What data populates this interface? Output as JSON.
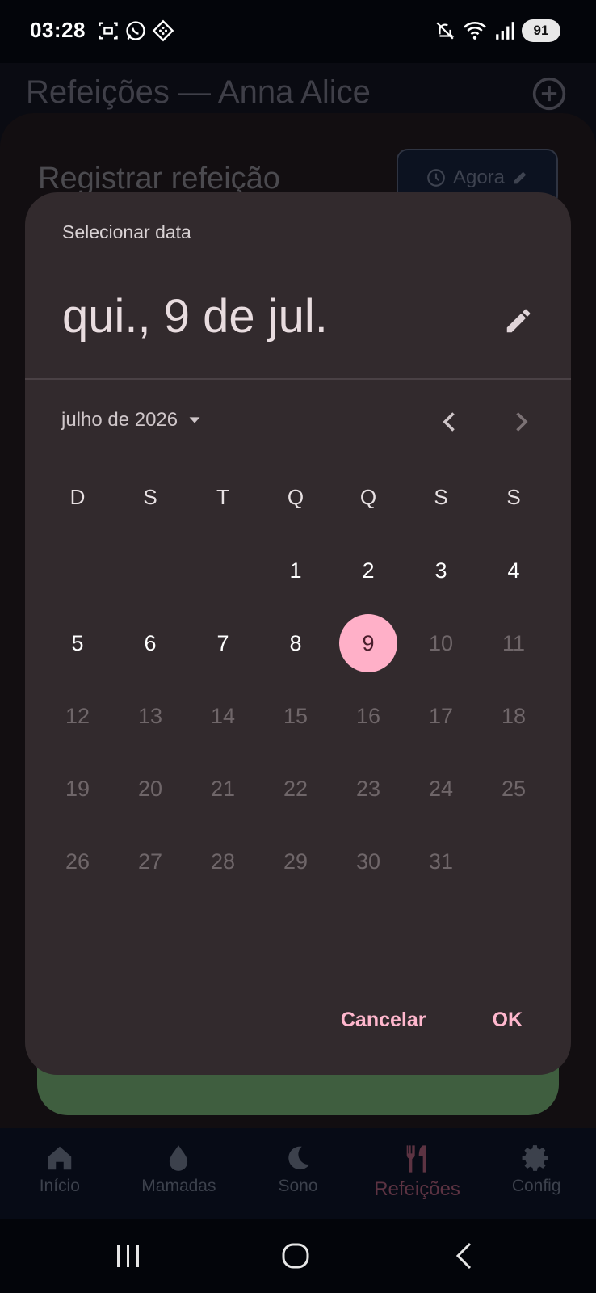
{
  "status_bar": {
    "time": "03:28",
    "battery": "91",
    "left_icons": [
      "screenshot-icon",
      "whatsapp-icon",
      "app-grid-icon"
    ],
    "right_icons": [
      "mute-icon",
      "wifi-icon",
      "signal-icon"
    ]
  },
  "app": {
    "title": "Refeições — Anna Alice",
    "sheet_title": "Registrar refeição",
    "now_chip_label": "Agora"
  },
  "dialog": {
    "heading": "Selecionar data",
    "selected_date": "qui., 9 de jul.",
    "month_label": "julho de 2026",
    "weekdays": [
      "D",
      "S",
      "T",
      "Q",
      "Q",
      "S",
      "S"
    ],
    "weeks": [
      [
        "",
        "",
        "",
        "1",
        "2",
        "3",
        "4"
      ],
      [
        "5",
        "6",
        "7",
        "8",
        "9",
        "10",
        "11"
      ],
      [
        "12",
        "13",
        "14",
        "15",
        "16",
        "17",
        "18"
      ],
      [
        "19",
        "20",
        "21",
        "22",
        "23",
        "24",
        "25"
      ],
      [
        "26",
        "27",
        "28",
        "29",
        "30",
        "31",
        ""
      ]
    ],
    "selected_day": "9",
    "cancel_label": "Cancelar",
    "ok_label": "OK"
  },
  "bottom_nav": {
    "items": [
      {
        "label": "Início",
        "icon": "home-icon"
      },
      {
        "label": "Mamadas",
        "icon": "drop-icon"
      },
      {
        "label": "Sono",
        "icon": "moon-icon"
      },
      {
        "label": "Refeições",
        "icon": "utensils-icon"
      },
      {
        "label": "Config",
        "icon": "gear-icon"
      }
    ],
    "active": "Refeições"
  },
  "colors": {
    "dialog_bg": "#322a2d",
    "accent": "#ffb0c8",
    "action_text": "#ffb7cd",
    "future_day": "#6f6669"
  }
}
